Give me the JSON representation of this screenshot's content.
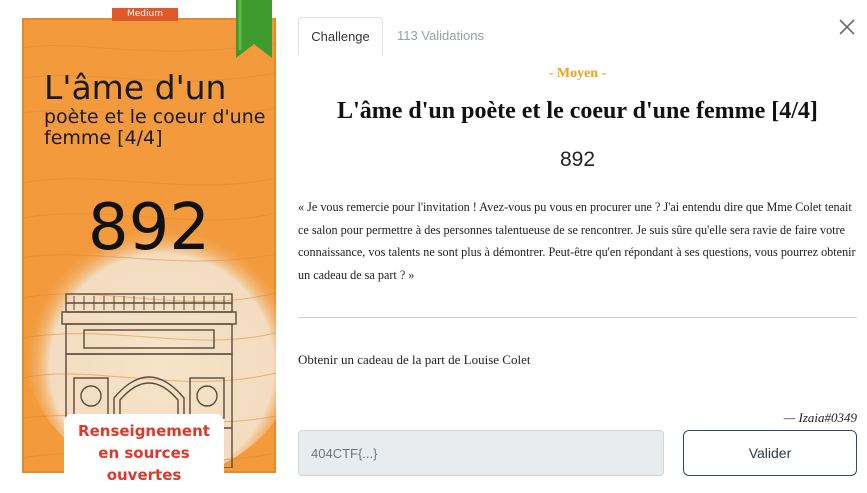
{
  "card": {
    "difficulty_tag": "Medium",
    "title_line1": "L'âme d'un",
    "title_rest": "poète et le coeur d'une femme [4/4]",
    "points": "892",
    "category": "Renseignement en sources ouvertes",
    "ribbon_icon": "ribbon-icon",
    "illustration": "arc-de-triomphe-illustration"
  },
  "tabs": [
    {
      "label": "Challenge",
      "active": true
    },
    {
      "label": "113 Validations",
      "active": false
    }
  ],
  "close_icon": "close-icon",
  "challenge": {
    "difficulty": "- Moyen -",
    "title": "L'âme d'un poète et le coeur d'une femme [4/4]",
    "points": "892",
    "description": "« Je vous remercie pour l'invitation ! Avez-vous pu vous en procurer une ? J'ai entendu dire que Mme Colet tenait ce salon pour permettre à des personnes talentueuse de se rencontrer. Je suis sûre qu'elle sera ravie de faire votre connaissance, vos talents ne sont plus à démontrer. Peut-être qu'en répondant à ses questions, vous pourrez obtenir un cadeau de sa part ? »",
    "objective": "Obtenir un cadeau de la part de Louise Colet",
    "author": "— Izaia#0349"
  },
  "form": {
    "flag_placeholder": "404CTF{...}",
    "submit_label": "Valider"
  },
  "colors": {
    "card_orange": "#f29a3c",
    "tag_red": "#e0582a",
    "category_red": "#e0372a",
    "difficulty_gold": "#f0a020",
    "ribbon_green": "#3f9a2e"
  }
}
